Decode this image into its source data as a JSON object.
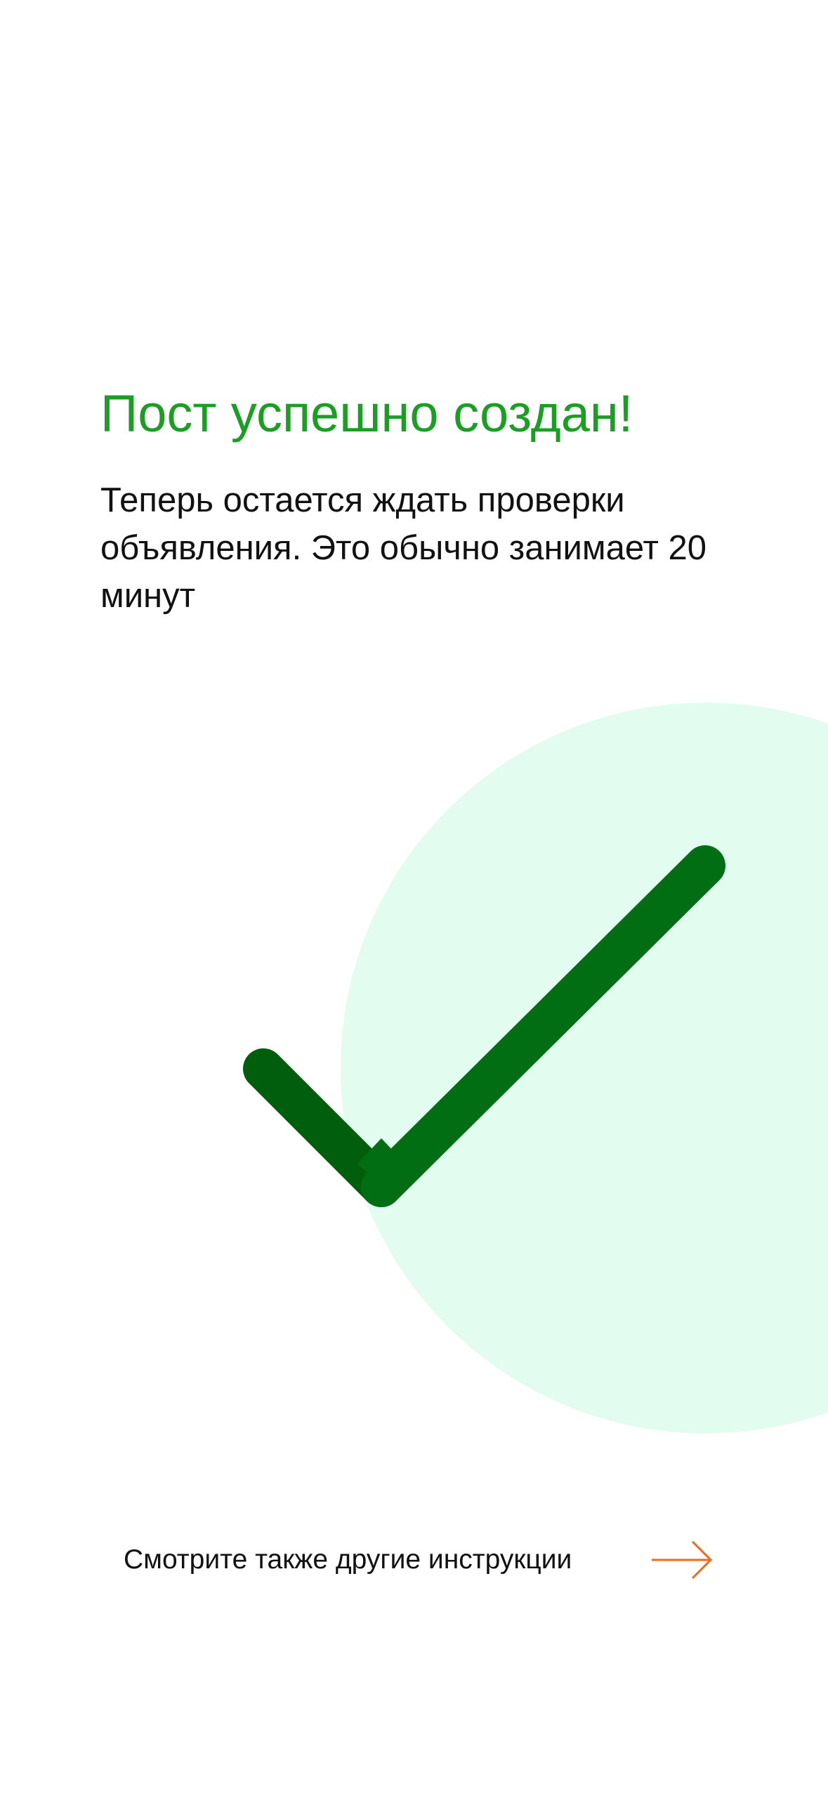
{
  "success": {
    "title": "Пост успешно создан!",
    "message": "Теперь остается ждать проверки объявления. Это обычно занимает 20 минут"
  },
  "illustration": {
    "icon": "checkmark-icon",
    "circle_color": "#e2fdef",
    "check_color": "#026e13"
  },
  "footer": {
    "link_label": "Смотрите также другие инструкции",
    "arrow_icon": "arrow-right-icon",
    "arrow_color": "#ee6a1b"
  },
  "colors": {
    "title": "#1c9e24",
    "text": "#111111",
    "background": "#ffffff"
  }
}
